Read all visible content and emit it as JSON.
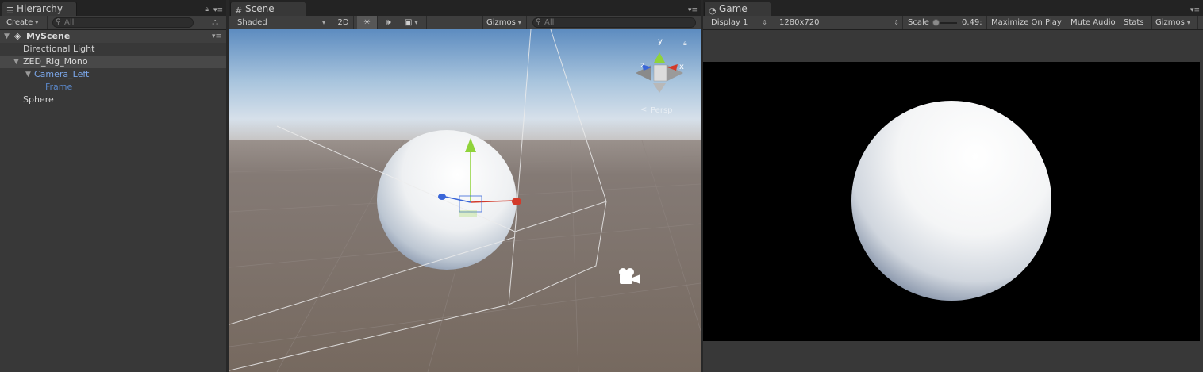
{
  "hierarchy": {
    "tab": "Hierarchy",
    "create": "Create",
    "search_placeholder": "All",
    "scene_name": "MyScene",
    "items": [
      {
        "label": "Directional Light"
      },
      {
        "label": "ZED_Rig_Mono"
      },
      {
        "label": "Camera_Left"
      },
      {
        "label": "Frame"
      },
      {
        "label": "Sphere"
      }
    ]
  },
  "scene": {
    "tab": "Scene",
    "shading": "Shaded",
    "mode_2d": "2D",
    "gizmos": "Gizmos",
    "search_placeholder": "All",
    "persp_label": "Persp",
    "axis_y": "y",
    "axis_x": "x",
    "axis_z": "z"
  },
  "game": {
    "tab": "Game",
    "display": "Display 1",
    "resolution": "1280x720",
    "scale_label": "Scale",
    "scale_value": "0.49:",
    "maximize": "Maximize On Play",
    "mute": "Mute Audio",
    "stats": "Stats",
    "gizmos": "Gizmos",
    "scale_fraction": 0.1
  },
  "colors": {
    "panel": "#383838",
    "toolbar": "#3e3e3e",
    "selection": "#484848",
    "prefab_blue": "#7ba6e8",
    "sky_top": "#5d8cc0",
    "ground": "#7b6f6a",
    "axis_x": "#d33a2a",
    "axis_y": "#8fd33a",
    "axis_z": "#3a66d8"
  }
}
